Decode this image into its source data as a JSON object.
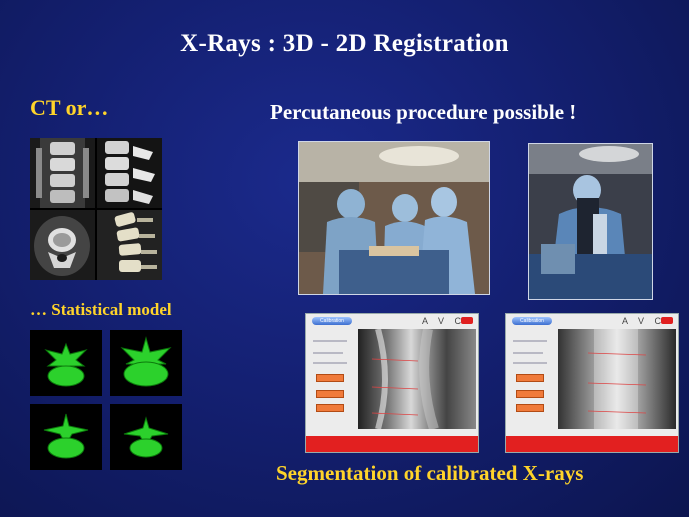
{
  "slide": {
    "title": "X-Rays : 3D - 2D Registration",
    "ct_label": "CT or…",
    "statistical_label": "… Statistical model",
    "percutaneous_label": "Percutaneous procedure possible !",
    "segmentation_label": "Segmentation of calibrated X-rays"
  },
  "app_windows": [
    {
      "tab": "Calibration",
      "brand": "A V C"
    },
    {
      "tab": "Calibration",
      "brand": "A V C"
    }
  ],
  "colors": {
    "background": "#142072",
    "title": "#ffffff",
    "label_yellow": "#ffd42a",
    "model_green": "#2cd12c",
    "app_red": "#e22020"
  }
}
